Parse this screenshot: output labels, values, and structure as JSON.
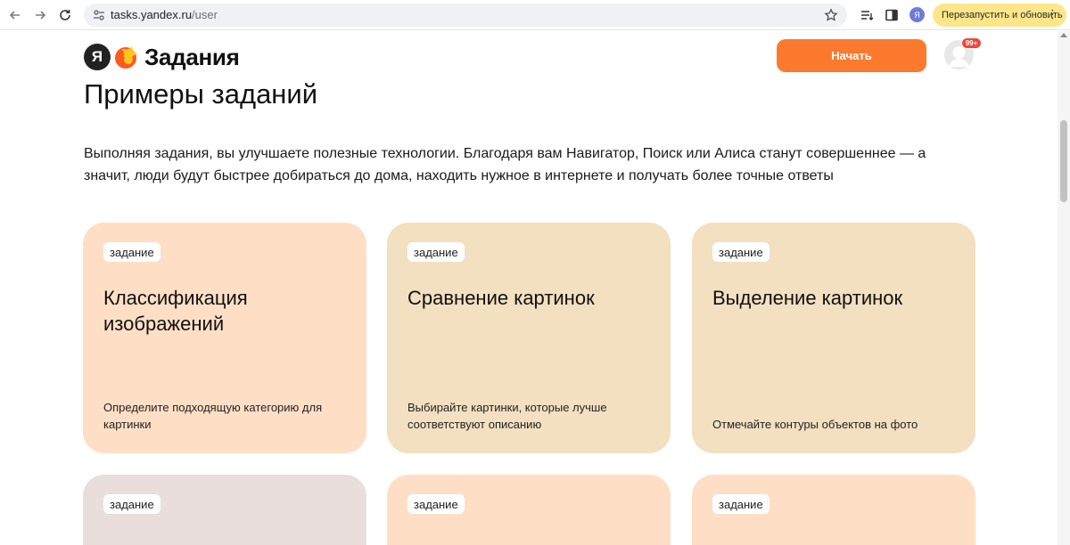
{
  "browser": {
    "url_host": "tasks.yandex.ru",
    "url_path": "/user",
    "profile_initial": "Я",
    "relaunch_label": "Перезапустить и обновить",
    "menu_glyph": "⋮"
  },
  "header": {
    "logo_letter": "Я",
    "logo_text": "Задания",
    "start_label": "Начать",
    "badge": "99+"
  },
  "page": {
    "title": "Примеры заданий",
    "intro": "Выполняя задания, вы улучшаете полезные технологии. Благодаря вам Навигатор, Поиск или Алиса станут совершеннее — а значит, люди будут быстрее добираться до дома, находить нужное в интернете и получать более точные ответы"
  },
  "cards": [
    {
      "tag": "задание",
      "title": "Классификация изображений",
      "desc": "Определите подходящую категорию для картинки",
      "color": "#fedfc6"
    },
    {
      "tag": "задание",
      "title": "Сравнение картинок",
      "desc": "Выбирайте картинки, которые лучше соответствуют описанию",
      "color": "#f3e0c0"
    },
    {
      "tag": "задание",
      "title": "Выделение картинок",
      "desc": "Отмечайте контуры объектов на фото",
      "color": "#f3e0c0"
    },
    {
      "tag": "задание",
      "title": "",
      "desc": "",
      "color": "#eadedd"
    },
    {
      "tag": "задание",
      "title": "",
      "desc": "",
      "color": "#fedfc6"
    },
    {
      "tag": "задание",
      "title": "",
      "desc": "",
      "color": "#fedfc6"
    }
  ],
  "colors": {
    "accent": "#fc7a2e",
    "relaunch_bg": "#fde68a",
    "badge": "#f0463b"
  },
  "icons": {
    "back": "arrow-left-icon",
    "forward": "arrow-right-icon",
    "reload": "reload-icon",
    "site_info": "site-settings-icon",
    "bookmark": "star-icon",
    "reading_list": "reading-list-icon",
    "side_panel": "side-panel-icon",
    "menu": "kebab-menu-icon"
  }
}
